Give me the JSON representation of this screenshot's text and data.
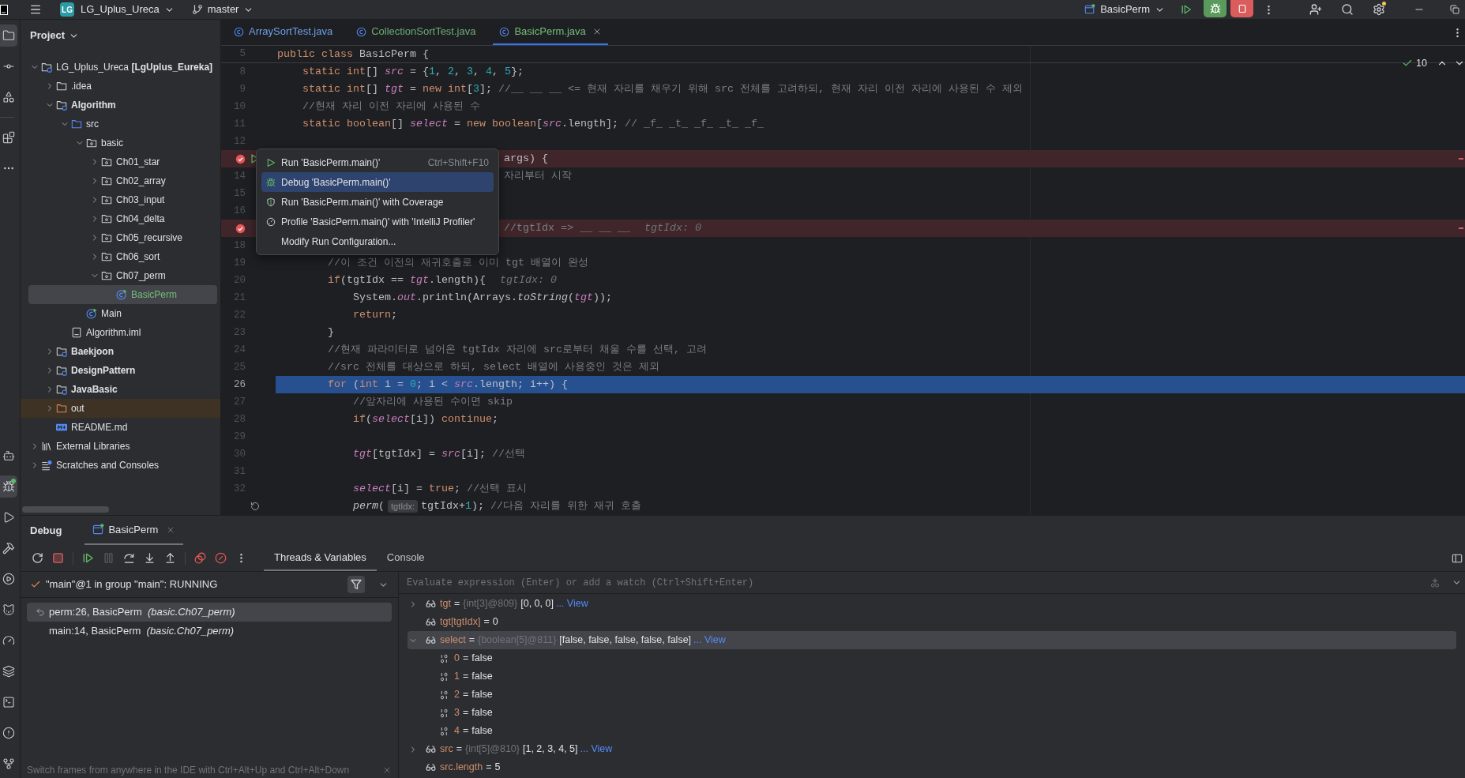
{
  "top_bar": {
    "project_badge": "LG",
    "project": "LG_Uplus_Ureca",
    "branch": "master",
    "run_config": "BasicPerm"
  },
  "tool_strip": {
    "top": [
      {
        "kind": "project",
        "selected": true
      },
      {
        "kind": "commit",
        "selected": false
      },
      {
        "kind": "structure",
        "selected": false
      },
      {
        "kind": "plugins",
        "selected": false
      },
      {
        "kind": "more",
        "selected": false
      }
    ],
    "bottom": [
      {
        "kind": "robot",
        "selected": false
      },
      {
        "kind": "debug",
        "selected": true
      },
      {
        "kind": "run",
        "selected": false
      },
      {
        "kind": "build",
        "selected": false
      },
      {
        "kind": "services",
        "selected": false
      },
      {
        "kind": "cat",
        "selected": false
      },
      {
        "kind": "profiler",
        "selected": false
      },
      {
        "kind": "layers",
        "selected": false
      },
      {
        "kind": "terminal",
        "selected": false
      },
      {
        "kind": "problems",
        "selected": false
      },
      {
        "kind": "git",
        "selected": false
      }
    ]
  },
  "project_panel": {
    "title": "Project",
    "tree": [
      {
        "label": "LG_Uplus_Ureca **[LgUplus_Eureka]**",
        "kind": "project",
        "expanded": true,
        "selected": false,
        "children": [
          {
            "label": ".idea",
            "kind": "folder",
            "expanded": false,
            "selected": false
          },
          {
            "label": "Algorithm",
            "kind": "module",
            "expanded": true,
            "selected": false,
            "children": [
              {
                "label": "src",
                "kind": "source",
                "expanded": true,
                "selected": false,
                "children": [
                  {
                    "label": "basic",
                    "kind": "package",
                    "expanded": true,
                    "selected": false,
                    "children": [
                      {
                        "label": "Ch01_star",
                        "kind": "package",
                        "expanded": false,
                        "selected": false
                      },
                      {
                        "label": "Ch02_array",
                        "kind": "package",
                        "expanded": false,
                        "selected": false
                      },
                      {
                        "label": "Ch03_input",
                        "kind": "package",
                        "expanded": false,
                        "selected": false
                      },
                      {
                        "label": "Ch04_delta",
                        "kind": "package",
                        "expanded": false,
                        "selected": false
                      },
                      {
                        "label": "Ch05_recursive",
                        "kind": "package",
                        "expanded": false,
                        "selected": false
                      },
                      {
                        "label": "Ch06_sort",
                        "kind": "package",
                        "expanded": false,
                        "selected": false
                      },
                      {
                        "label": "Ch07_perm",
                        "kind": "package",
                        "expanded": true,
                        "selected": false,
                        "children": [
                          {
                            "label": "BasicPerm",
                            "kind": "class",
                            "selected": true,
                            "color": "#73bd79"
                          }
                        ]
                      }
                    ]
                  },
                  {
                    "label": "Main",
                    "kind": "class",
                    "selected": false
                  }
                ]
              },
              {
                "label": "Algorithm.iml",
                "kind": "file",
                "selected": false
              }
            ]
          },
          {
            "label": "Baekjoon",
            "kind": "module",
            "expanded": false,
            "selected": false
          },
          {
            "label": "DesignPattern",
            "kind": "module",
            "expanded": false,
            "selected": false
          },
          {
            "label": "JavaBasic",
            "kind": "module",
            "expanded": false,
            "selected": false
          },
          {
            "label": "out",
            "kind": "excluded",
            "expanded": false,
            "selected": false
          },
          {
            "label": "README.md",
            "kind": "markdown",
            "selected": false
          }
        ]
      },
      {
        "label": "External Libraries",
        "kind": "libraries",
        "expanded": false,
        "selected": false
      },
      {
        "label": "Scratches and Consoles",
        "kind": "scratches",
        "expanded": false,
        "selected": false
      }
    ]
  },
  "editor": {
    "tabs": [
      {
        "label": "ArraySortTest.java",
        "color": "#6e9fe6",
        "selected": false
      },
      {
        "label": "CollectionSortTest.java",
        "color": "#6aab73",
        "selected": false
      },
      {
        "label": "BasicPerm.java",
        "color": "#73bd79",
        "selected": true
      }
    ],
    "inspection_count": "10",
    "lines": [
      {
        "number": "5",
        "kind": "sticky",
        "breakpoint": false,
        "current": false,
        "parts": [
          {
            "kind": "code",
            "tokens": [
              {
                "kind": "keyword",
                "text": "public class "
              },
              {
                "kind": "plain",
                "text": "BasicPerm {"
              }
            ]
          }
        ]
      },
      {
        "number": "8",
        "kind": "code",
        "breakpoint": false,
        "current": false,
        "parts": [
          {
            "kind": "code",
            "tokens": [
              {
                "kind": "keyword",
                "text": "    static int"
              },
              {
                "kind": "plain",
                "text": "[] "
              },
              {
                "kind": "field",
                "text": "src"
              },
              {
                "kind": "plain",
                "text": " = {"
              },
              {
                "kind": "number",
                "text": "1"
              },
              {
                "kind": "plain",
                "text": ", "
              },
              {
                "kind": "number",
                "text": "2"
              },
              {
                "kind": "plain",
                "text": ", "
              },
              {
                "kind": "number",
                "text": "3"
              },
              {
                "kind": "plain",
                "text": ", "
              },
              {
                "kind": "number",
                "text": "4"
              },
              {
                "kind": "plain",
                "text": ", "
              },
              {
                "kind": "number",
                "text": "5"
              },
              {
                "kind": "plain",
                "text": "};"
              }
            ]
          }
        ]
      },
      {
        "number": "9",
        "kind": "code",
        "breakpoint": false,
        "current": false,
        "parts": [
          {
            "kind": "code",
            "tokens": [
              {
                "kind": "keyword",
                "text": "    static int"
              },
              {
                "kind": "plain",
                "text": "[] "
              },
              {
                "kind": "field",
                "text": "tgt"
              },
              {
                "kind": "plain",
                "text": " = "
              },
              {
                "kind": "keyword",
                "text": "new int"
              },
              {
                "kind": "plain",
                "text": "["
              },
              {
                "kind": "number",
                "text": "3"
              },
              {
                "kind": "plain",
                "text": "]; "
              },
              {
                "kind": "comment",
                "text": "//__ __ __ <= 현재 자리를 채우기 위해 src 전체를 고려하되, 현재 자리 이전 자리에 사용된 수 제외"
              }
            ]
          }
        ]
      },
      {
        "number": "10",
        "kind": "code",
        "breakpoint": false,
        "current": false,
        "parts": [
          {
            "kind": "code",
            "tokens": [
              {
                "kind": "comment",
                "text": "    //현재 자리 이전 자리에 사용된 수"
              }
            ]
          }
        ]
      },
      {
        "number": "11",
        "kind": "code",
        "breakpoint": false,
        "current": false,
        "parts": [
          {
            "kind": "code",
            "tokens": [
              {
                "kind": "keyword",
                "text": "    static boolean"
              },
              {
                "kind": "plain",
                "text": "[] "
              },
              {
                "kind": "field",
                "text": "select"
              },
              {
                "kind": "plain",
                "text": " = "
              },
              {
                "kind": "keyword",
                "text": "new boolean"
              },
              {
                "kind": "plain",
                "text": "["
              },
              {
                "kind": "field",
                "text": "src"
              },
              {
                "kind": "plain",
                "text": ".length]; "
              },
              {
                "kind": "comment",
                "text": "// _f_ _t_ _f_ _t_ _f_"
              }
            ]
          }
        ]
      },
      {
        "number": "12",
        "kind": "code",
        "breakpoint": false,
        "current": false
      },
      {
        "kind": "covered",
        "breakpoint": true,
        "current": false,
        "gutter_mark": {
          "kind": "run"
        },
        "parts": [
          {
            "kind": "code",
            "tokens": [
              {
                "kind": "plain",
                "text": "args) {"
              }
            ]
          }
        ]
      },
      {
        "number": "14",
        "kind": "covered",
        "breakpoint": false,
        "current": false,
        "parts": [
          {
            "kind": "code",
            "tokens": [
              {
                "kind": "comment",
                "text": "자리부터 시작"
              }
            ]
          }
        ]
      },
      {
        "number": "15",
        "kind": "code",
        "breakpoint": false,
        "current": false
      },
      {
        "number": "16",
        "kind": "code",
        "breakpoint": false,
        "current": false
      },
      {
        "kind": "covered",
        "breakpoint": true,
        "current": false,
        "parts": [
          {
            "kind": "code",
            "tokens": [
              {
                "kind": "comment",
                "text": "//tgtIdx => __ __ __"
              }
            ]
          },
          {
            "kind": "hint",
            "text": "tgtIdx: 0"
          }
        ]
      },
      {
        "number": "18",
        "kind": "code",
        "breakpoint": false,
        "current": false
      },
      {
        "number": "19",
        "kind": "code",
        "breakpoint": false,
        "current": false,
        "parts": [
          {
            "kind": "code",
            "tokens": [
              {
                "kind": "comment",
                "text": "        //이 조건 이전의 재귀호출로 이미 tgt 배열이 완성"
              }
            ]
          }
        ]
      },
      {
        "number": "20",
        "kind": "code",
        "breakpoint": false,
        "current": false,
        "parts": [
          {
            "kind": "code",
            "tokens": [
              {
                "kind": "keyword",
                "text": "        if"
              },
              {
                "kind": "plain",
                "text": "(tgtIdx == "
              },
              {
                "kind": "field",
                "text": "tgt"
              },
              {
                "kind": "plain",
                "text": ".length){"
              }
            ]
          },
          {
            "kind": "hint",
            "text": "tgtIdx: 0"
          }
        ]
      },
      {
        "number": "21",
        "kind": "code",
        "breakpoint": false,
        "current": false,
        "parts": [
          {
            "kind": "code",
            "tokens": [
              {
                "kind": "plain",
                "text": "            System."
              },
              {
                "kind": "field",
                "text": "out"
              },
              {
                "kind": "plain",
                "text": ".println(Arrays."
              },
              {
                "kind": "static_call",
                "text": "toString"
              },
              {
                "kind": "plain",
                "text": "("
              },
              {
                "kind": "field",
                "text": "tgt"
              },
              {
                "kind": "plain",
                "text": "));"
              }
            ]
          }
        ]
      },
      {
        "number": "22",
        "kind": "code",
        "breakpoint": false,
        "current": false,
        "parts": [
          {
            "kind": "code",
            "tokens": [
              {
                "kind": "keyword",
                "text": "            return"
              },
              {
                "kind": "plain",
                "text": ";"
              }
            ]
          }
        ]
      },
      {
        "number": "23",
        "kind": "code",
        "breakpoint": false,
        "current": false,
        "parts": [
          {
            "kind": "code",
            "tokens": [
              {
                "kind": "plain",
                "text": "        }"
              }
            ]
          }
        ]
      },
      {
        "number": "24",
        "kind": "code",
        "breakpoint": false,
        "current": false,
        "parts": [
          {
            "kind": "code",
            "tokens": [
              {
                "kind": "comment",
                "text": "        //현재 파라미터로 넘어온 tgtIdx 자리에 src로부터 채울 수를 선택, 고려"
              }
            ]
          }
        ]
      },
      {
        "number": "25",
        "kind": "code",
        "breakpoint": false,
        "current": false,
        "parts": [
          {
            "kind": "code",
            "tokens": [
              {
                "kind": "comment",
                "text": "        //src 전체를 대상으로 하되, select 배열에 사용중인 것은 제외"
              }
            ]
          }
        ]
      },
      {
        "number": "26",
        "kind": "code",
        "breakpoint": false,
        "current": true,
        "parts": [
          {
            "kind": "code",
            "tokens": [
              {
                "kind": "keyword",
                "text": "        for "
              },
              {
                "kind": "plain",
                "text": "("
              },
              {
                "kind": "keyword",
                "text": "int "
              },
              {
                "kind": "plain",
                "text": "i = "
              },
              {
                "kind": "number",
                "text": "0"
              },
              {
                "kind": "plain",
                "text": "; i < "
              },
              {
                "kind": "field",
                "text": "src"
              },
              {
                "kind": "plain",
                "text": ".length; i++) {"
              }
            ]
          }
        ]
      },
      {
        "number": "27",
        "kind": "code",
        "breakpoint": false,
        "current": false,
        "parts": [
          {
            "kind": "code",
            "tokens": [
              {
                "kind": "comment",
                "text": "            //앞자리에 사용된 수이면 skip"
              }
            ]
          }
        ]
      },
      {
        "number": "28",
        "kind": "code",
        "breakpoint": false,
        "current": false,
        "parts": [
          {
            "kind": "code",
            "tokens": [
              {
                "kind": "keyword",
                "text": "            if"
              },
              {
                "kind": "plain",
                "text": "("
              },
              {
                "kind": "field",
                "text": "select"
              },
              {
                "kind": "plain",
                "text": "[i]) "
              },
              {
                "kind": "keyword",
                "text": "continue"
              },
              {
                "kind": "plain",
                "text": ";"
              }
            ]
          }
        ]
      },
      {
        "number": "29",
        "kind": "code",
        "breakpoint": false,
        "current": false
      },
      {
        "number": "30",
        "kind": "code",
        "breakpoint": false,
        "current": false,
        "parts": [
          {
            "kind": "code",
            "tokens": [
              {
                "kind": "field",
                "text": "            tgt"
              },
              {
                "kind": "plain",
                "text": "[tgtIdx] = "
              },
              {
                "kind": "field",
                "text": "src"
              },
              {
                "kind": "plain",
                "text": "[i]; "
              },
              {
                "kind": "comment",
                "text": "//선택"
              }
            ]
          }
        ]
      },
      {
        "number": "31",
        "kind": "code",
        "breakpoint": false,
        "current": false
      },
      {
        "number": "32",
        "kind": "code",
        "breakpoint": false,
        "current": false,
        "parts": [
          {
            "kind": "code",
            "tokens": [
              {
                "kind": "field",
                "text": "            select"
              },
              {
                "kind": "plain",
                "text": "[i] = "
              },
              {
                "kind": "keyword",
                "text": "true"
              },
              {
                "kind": "plain",
                "text": "; "
              },
              {
                "kind": "comment",
                "text": "//선택 표시"
              }
            ]
          }
        ]
      },
      {
        "kind": "code",
        "breakpoint": false,
        "current": false,
        "gutter_mark": {
          "kind": "recursion"
        },
        "parts": [
          {
            "kind": "code",
            "tokens": [
              {
                "kind": "static_call",
                "text": "            perm"
              },
              {
                "kind": "plain",
                "text": "("
              }
            ]
          },
          {
            "kind": "param",
            "text": "tgtIdx:"
          },
          {
            "kind": "code",
            "tokens": [
              {
                "kind": "plain",
                "text": "tgtIdx+"
              },
              {
                "kind": "number",
                "text": "1"
              },
              {
                "kind": "plain",
                "text": "); "
              },
              {
                "kind": "comment",
                "text": "//다음 자리를 위한 재귀 호출"
              }
            ]
          }
        ]
      }
    ],
    "context_menu": [
      {
        "kind": "run",
        "label": "Run 'BasicPerm.main()'",
        "shortcut": "Ctrl+Shift+F10",
        "selected": false
      },
      {
        "kind": "debug",
        "label": "Debug 'BasicPerm.main()'",
        "selected": true
      },
      {
        "kind": "coverage",
        "label": "Run 'BasicPerm.main()' with Coverage",
        "selected": false
      },
      {
        "kind": "profile",
        "label": "Profile 'BasicPerm.main()' with 'IntelliJ Profiler'",
        "selected": false
      },
      {
        "kind": "plain",
        "label": "Modify Run Configuration...",
        "selected": false
      }
    ]
  },
  "debug": {
    "title": "Debug",
    "session": {
      "label": "BasicPerm",
      "selected": true
    },
    "toolbar": [
      {
        "kind": "rerun",
        "disabled": false
      },
      {
        "kind": "stop",
        "disabled": false
      },
      {
        "kind": "resume",
        "disabled": false
      },
      {
        "kind": "pause",
        "disabled": true
      },
      {
        "kind": "step_over",
        "disabled": false
      },
      {
        "kind": "step_into",
        "disabled": false
      },
      {
        "kind": "step_out",
        "disabled": false
      },
      {
        "kind": "breakpoints",
        "disabled": false
      },
      {
        "kind": "mute",
        "disabled": false
      },
      {
        "kind": "more",
        "disabled": false
      }
    ],
    "tabs": [
      {
        "label": "Threads & Variables",
        "selected": true
      },
      {
        "label": "Console",
        "selected": false
      }
    ],
    "thread": "\"main\"@1 in group \"main\": RUNNING",
    "frames": [
      {
        "text": "perm:26, BasicPerm  *(basic.Ch07_perm)*",
        "selected": true
      },
      {
        "text": "main:14, BasicPerm  *(basic.Ch07_perm)*",
        "selected": false
      }
    ],
    "hint": "Switch frames from anywhere in the IDE with Ctrl+Alt+Up and Ctrl+Alt+Down",
    "evaluate": {
      "placeholder": "Evaluate expression (Enter) or add a watch (Ctrl+Shift+Enter)"
    },
    "variables": [
      {
        "kind": "watch",
        "name": "tgt",
        "op": "=",
        "type": "{int[3]@809}",
        "value": "[0, 0, 0]",
        "link": "... View",
        "expanded": false,
        "selected": false
      },
      {
        "kind": "watch",
        "name": "tgt[tgtIdx]",
        "op": "=",
        "value": "0",
        "selected": false
      },
      {
        "kind": "watch",
        "name": "select",
        "op": "=",
        "type": "{boolean[5]@811}",
        "value": "[false, false, false, false, false]",
        "link": "... View",
        "expanded": true,
        "selected": true,
        "children": [
          {
            "kind": "element",
            "name": "0",
            "op": "=",
            "value": "false",
            "selected": false
          },
          {
            "kind": "element",
            "name": "1",
            "op": "=",
            "value": "false",
            "selected": false
          },
          {
            "kind": "element",
            "name": "2",
            "op": "=",
            "value": "false",
            "selected": false
          },
          {
            "kind": "element",
            "name": "3",
            "op": "=",
            "value": "false",
            "selected": false
          },
          {
            "kind": "element",
            "name": "4",
            "op": "=",
            "value": "false",
            "selected": false
          }
        ]
      },
      {
        "kind": "watch",
        "name": "src",
        "op": "=",
        "type": "{int[5]@810}",
        "value": "[1, 2, 3, 4, 5]",
        "link": "... View",
        "expanded": false,
        "selected": false
      },
      {
        "kind": "watch",
        "name": "src.length",
        "op": "=",
        "value": "5",
        "selected": false
      }
    ]
  }
}
